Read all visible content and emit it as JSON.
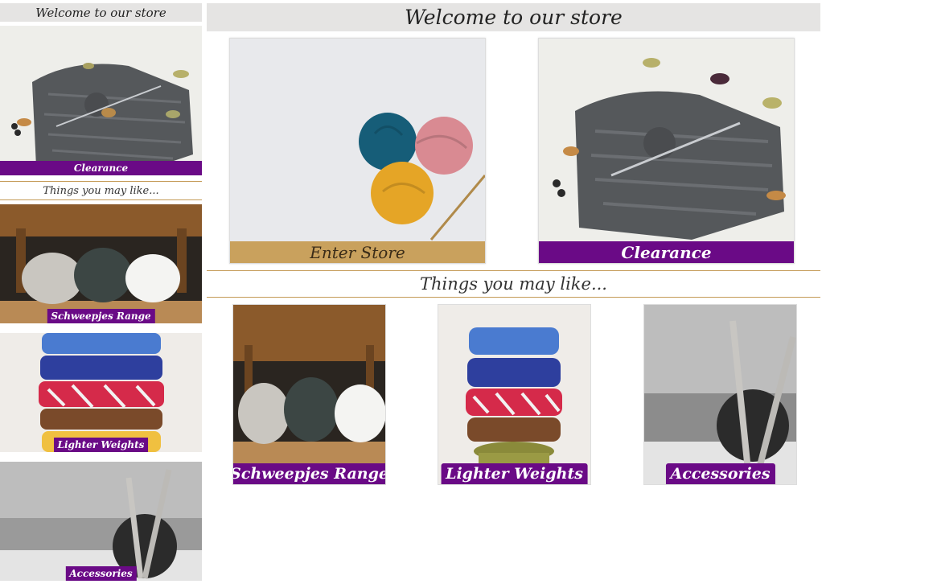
{
  "header": {
    "title": "Welcome to our store"
  },
  "hero": {
    "enter": {
      "label": "Enter Store",
      "bar_color": "#c9a15d"
    },
    "clearance": {
      "label": "Clearance",
      "bar_color": "#6a0a86"
    }
  },
  "things": {
    "heading": "Things you may like..."
  },
  "products": [
    {
      "label": "Schweepjes Range"
    },
    {
      "label": "Lighter Weights"
    },
    {
      "label": "Accessories"
    }
  ],
  "colors": {
    "accent": "#6a0a86",
    "gold": "#c9a15d",
    "header_bg": "#e5e4e3"
  }
}
